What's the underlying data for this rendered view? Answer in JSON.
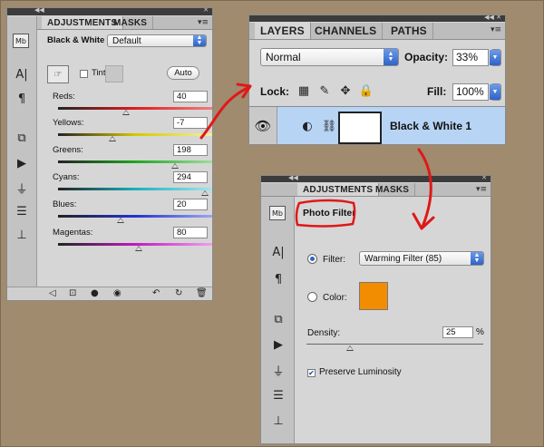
{
  "adj_bw": {
    "tabs": [
      "ADJUSTMENTS",
      "MASKS"
    ],
    "preset_label": "Black & White",
    "preset_value": "Default",
    "tint_label": "Tint",
    "auto_label": "Auto",
    "sliders": [
      {
        "label": "Reds:",
        "value": "40"
      },
      {
        "label": "Yellows:",
        "value": "-7"
      },
      {
        "label": "Greens:",
        "value": "198"
      },
      {
        "label": "Cyans:",
        "value": "294"
      },
      {
        "label": "Blues:",
        "value": "20"
      },
      {
        "label": "Magentas:",
        "value": "80"
      }
    ],
    "tool_icons": [
      "mb-icon",
      "type-icon",
      "paragraph-icon",
      "levels-icon",
      "play-icon",
      "usb-icon",
      "sliders-icon",
      "stamp-icon"
    ],
    "bottom_icons": [
      "back-arrow-icon",
      "clip-icon",
      "circle-icon",
      "eye-icon",
      "reset-icon",
      "refresh-icon",
      "trash-icon"
    ]
  },
  "layers": {
    "tabs": [
      "LAYERS",
      "CHANNELS",
      "PATHS"
    ],
    "blend_mode": "Normal",
    "opacity_label": "Opacity:",
    "opacity_value": "33%",
    "lock_label": "Lock:",
    "fill_label": "Fill:",
    "fill_value": "100%",
    "layer_name": "Black & White 1"
  },
  "adj_pf": {
    "tabs": [
      "ADJUSTMENTS",
      "MASKS"
    ],
    "title": "Photo Filter",
    "filter_label": "Filter:",
    "filter_value": "Warming Filter (85)",
    "color_label": "Color:",
    "density_label": "Density:",
    "density_value": "25",
    "density_unit": "%",
    "preserve_label": "Preserve Luminosity"
  },
  "colors": {
    "background": "#a08b6f",
    "panel": "#d6d6d6",
    "annotation_red": "#e01818",
    "filter_color": "#f28c00",
    "selected_layer": "#b8d4f5"
  }
}
